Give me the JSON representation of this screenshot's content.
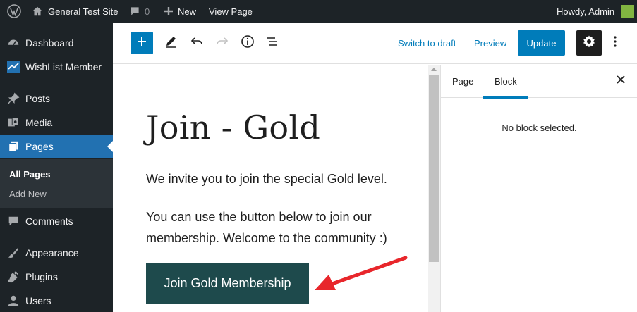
{
  "admin_bar": {
    "site_name": "General Test Site",
    "comments_count": "0",
    "new_label": "New",
    "view_page_label": "View Page",
    "howdy_text": "Howdy, Admin",
    "icons": [
      "wordpress-logo-icon",
      "home-icon",
      "comment-icon",
      "plus-icon"
    ],
    "avatar_color": "#82b541"
  },
  "sidebar": {
    "items": [
      {
        "label": "Dashboard",
        "icon": "dashboard-icon"
      },
      {
        "label": "WishList Member",
        "icon": "wishlist-icon"
      },
      {
        "label": "Posts",
        "icon": "pin-icon"
      },
      {
        "label": "Media",
        "icon": "media-icon"
      },
      {
        "label": "Pages",
        "icon": "pages-icon",
        "current": true
      },
      {
        "label": "Comments",
        "icon": "comment-icon"
      },
      {
        "label": "Appearance",
        "icon": "brush-icon"
      },
      {
        "label": "Plugins",
        "icon": "plug-icon"
      },
      {
        "label": "Users",
        "icon": "users-icon"
      }
    ],
    "submenu": [
      {
        "label": "All Pages",
        "active": true
      },
      {
        "label": "Add New"
      }
    ]
  },
  "toolbar": {
    "switch_to_draft": "Switch to draft",
    "preview": "Preview",
    "update": "Update",
    "icons": [
      "plus-icon",
      "pencil-icon",
      "undo-icon",
      "redo-icon",
      "info-icon",
      "list-view-icon",
      "gear-icon",
      "more-vertical-icon"
    ]
  },
  "content": {
    "title": "Join - Gold",
    "paragraph1": "We invite you to join the special Gold level.",
    "paragraph2_line1": "You can use the button below to join our",
    "paragraph2_line2": "membership. Welcome to the community :)",
    "button_label": "Join Gold Membership",
    "button_color": "#1e4a4c"
  },
  "settings_panel": {
    "tabs": [
      "Page",
      "Block"
    ],
    "active_tab": "Block",
    "empty_message": "No block selected."
  },
  "colors": {
    "admin_dark": "#1d2327",
    "accent_blue": "#007cba",
    "current_menu": "#2271b1",
    "annotation_red": "#e8262b"
  }
}
